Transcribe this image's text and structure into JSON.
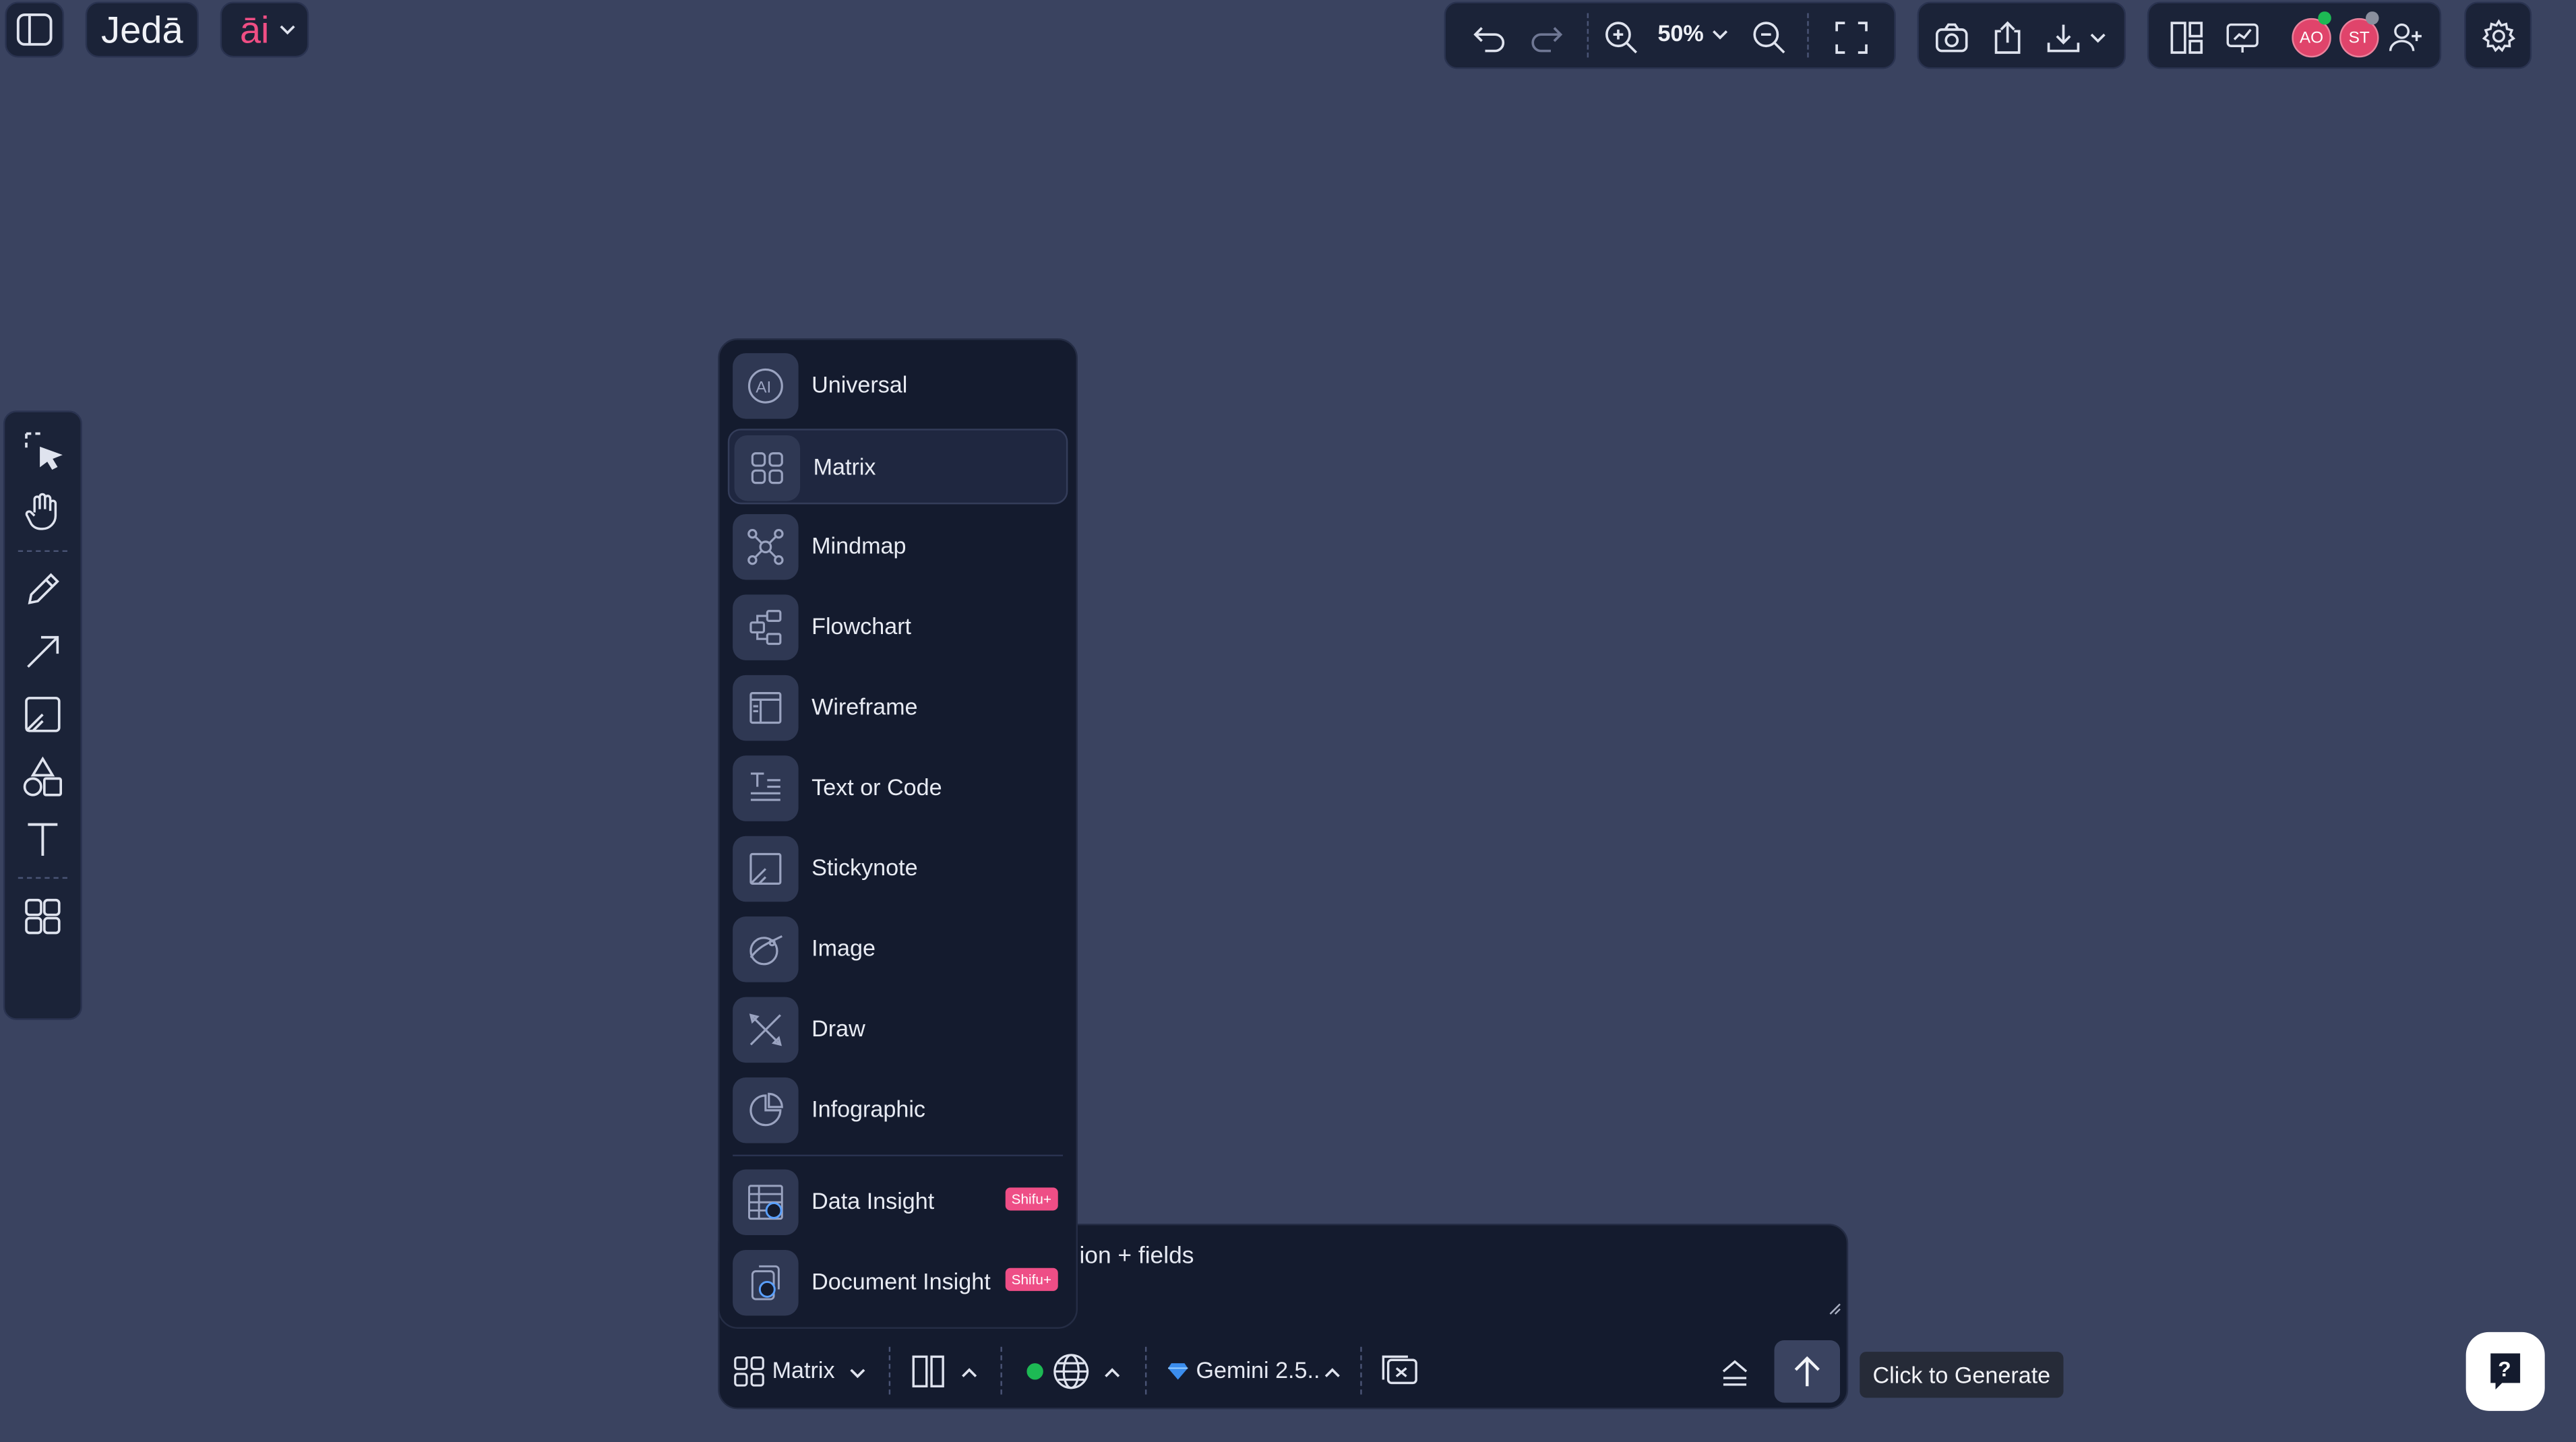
{
  "brand": {
    "logo_text": "Jedā",
    "ai_label": "āi"
  },
  "toolbar": {
    "zoom_level": "50%"
  },
  "users": [
    {
      "initials": "AO",
      "status": "online"
    },
    {
      "initials": "ST",
      "status": "offline"
    }
  ],
  "colors": {
    "canvas": "#3a4360",
    "panel": "#141b2e",
    "accent_pink": "#ee4e86",
    "online": "#1db954"
  },
  "generator_menu": {
    "items": [
      {
        "label": "Universal",
        "icon": "ai-circle-icon",
        "badge": ""
      },
      {
        "label": "Matrix",
        "icon": "grid-icon",
        "badge": "",
        "selected": true
      },
      {
        "label": "Mindmap",
        "icon": "mindmap-icon",
        "badge": ""
      },
      {
        "label": "Flowchart",
        "icon": "flowchart-icon",
        "badge": ""
      },
      {
        "label": "Wireframe",
        "icon": "wireframe-icon",
        "badge": ""
      },
      {
        "label": "Text or Code",
        "icon": "text-code-icon",
        "badge": ""
      },
      {
        "label": "Stickynote",
        "icon": "stickynote-icon",
        "badge": ""
      },
      {
        "label": "Image",
        "icon": "image-icon",
        "badge": ""
      },
      {
        "label": "Draw",
        "icon": "draw-icon",
        "badge": ""
      },
      {
        "label": "Infographic",
        "icon": "pie-chart-icon",
        "badge": ""
      },
      {
        "label": "Data Insight",
        "icon": "data-insight-icon",
        "badge": "Shifu+"
      },
      {
        "label": "Document Insight",
        "icon": "document-insight-icon",
        "badge": "Shifu+"
      }
    ]
  },
  "composer": {
    "prompt_text": "ion + fields",
    "mode_label": "Matrix",
    "model_label": "Gemini 2.5..",
    "web_status": "online"
  },
  "tooltip": {
    "generate": "Click to Generate"
  },
  "help": {
    "label": "?"
  }
}
